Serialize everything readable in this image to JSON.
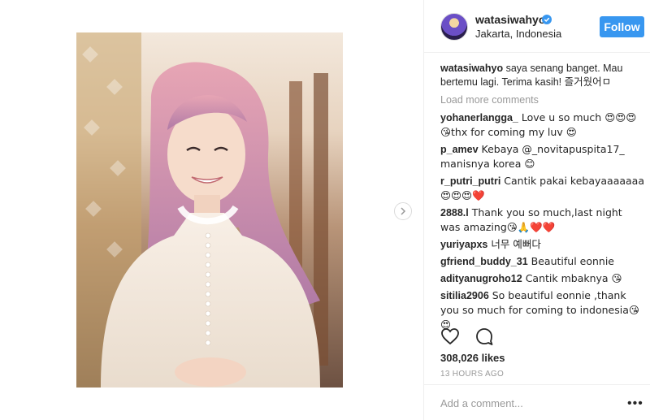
{
  "post": {
    "username": "watasiwahyo",
    "location": "Jakarta, Indonesia",
    "follow_label": "Follow",
    "caption_user": "watasiwahyo",
    "caption_text": " saya senang banget. Mau bertemu lagi. Terima kasih! 즐거웠어ㅁ",
    "load_more": "Load more comments",
    "likes": "308,026 likes",
    "time": "13 HOURS AGO",
    "add_comment_placeholder": "Add a comment...",
    "more_dots": "•••"
  },
  "comments": [
    {
      "user": "yohanerlangga_",
      "text": " Love u so much 😍😍😍😘thx for coming my luv 😍"
    },
    {
      "user": "p_amev",
      "text": " Kebaya @_novitapuspita17_ manisnya korea 😊"
    },
    {
      "user": "r_putri_putri",
      "text": " Cantik pakai kebayaaaaaaa 😍😍😍❤️"
    },
    {
      "user": "2888.l",
      "text": " Thank you so much,last night was amazing😘🙏❤️❤️"
    },
    {
      "user": "yuriyapxs",
      "text": " 너무 예뻐다"
    },
    {
      "user": "gfriend_buddy_31",
      "text": " Beautiful eonnie"
    },
    {
      "user": "adityanugroho12",
      "text": " Cantik mbaknya 😘"
    },
    {
      "user": "sitilia2906",
      "text": " So beautiful eonnie ,thank you so much for coming to indonesia😘😍"
    }
  ],
  "icons": {
    "heart": "heart-icon",
    "comment": "comment-icon",
    "verified": "verified-badge-icon",
    "next": "chevron-right-icon"
  },
  "colors": {
    "follow": "#3897f0",
    "muted": "#999999",
    "text": "#262626"
  }
}
